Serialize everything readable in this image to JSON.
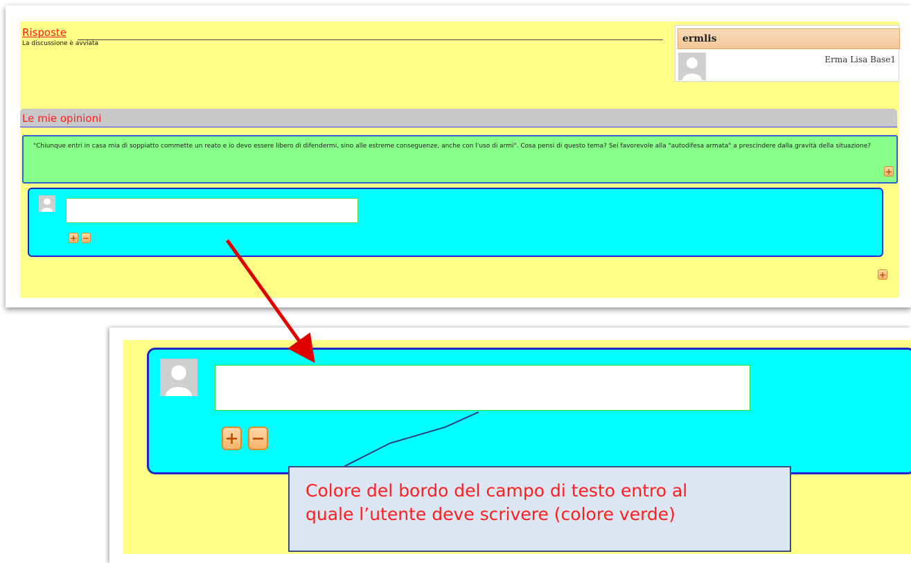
{
  "risposte": {
    "title": "Risposte",
    "status": "La discussione è avviata"
  },
  "user_card": {
    "username": "ermlis",
    "full_name": "Erma Lisa Base1"
  },
  "opinioni": {
    "title": "Le mie opinioni",
    "question_text": "\"Chiunque entri in casa mia di soppiatto commette un reato e io devo essere libero di difendermi, sino alle estreme conseguenze, anche con l'uso di armi\". Cosa pensi di questo tema? Sei favorevole alla \"autodifesa armata\" a prescindere dalla gravità della situazione?"
  },
  "buttons": {
    "plus": "+",
    "minus": "−"
  },
  "reply": {
    "input_value": "",
    "placeholder": ""
  },
  "callout": {
    "text_line1": "Colore del bordo del campo di testo entro al",
    "text_line2": "quale l’utente deve scrivere (colore verde)"
  },
  "colors": {
    "background_yellow": "#ffff88",
    "question_green": "#88ff88",
    "reply_cyan": "#00ffff",
    "input_border_green": "#33dd33",
    "title_red": "#ff1e1e",
    "arrow_red": "#e00000",
    "button_orange": "#f5b46a"
  },
  "icons": {
    "avatar": "user-silhouette-icon",
    "plus": "plus-icon",
    "minus": "minus-icon",
    "arrow": "arrow-down-right-icon"
  }
}
